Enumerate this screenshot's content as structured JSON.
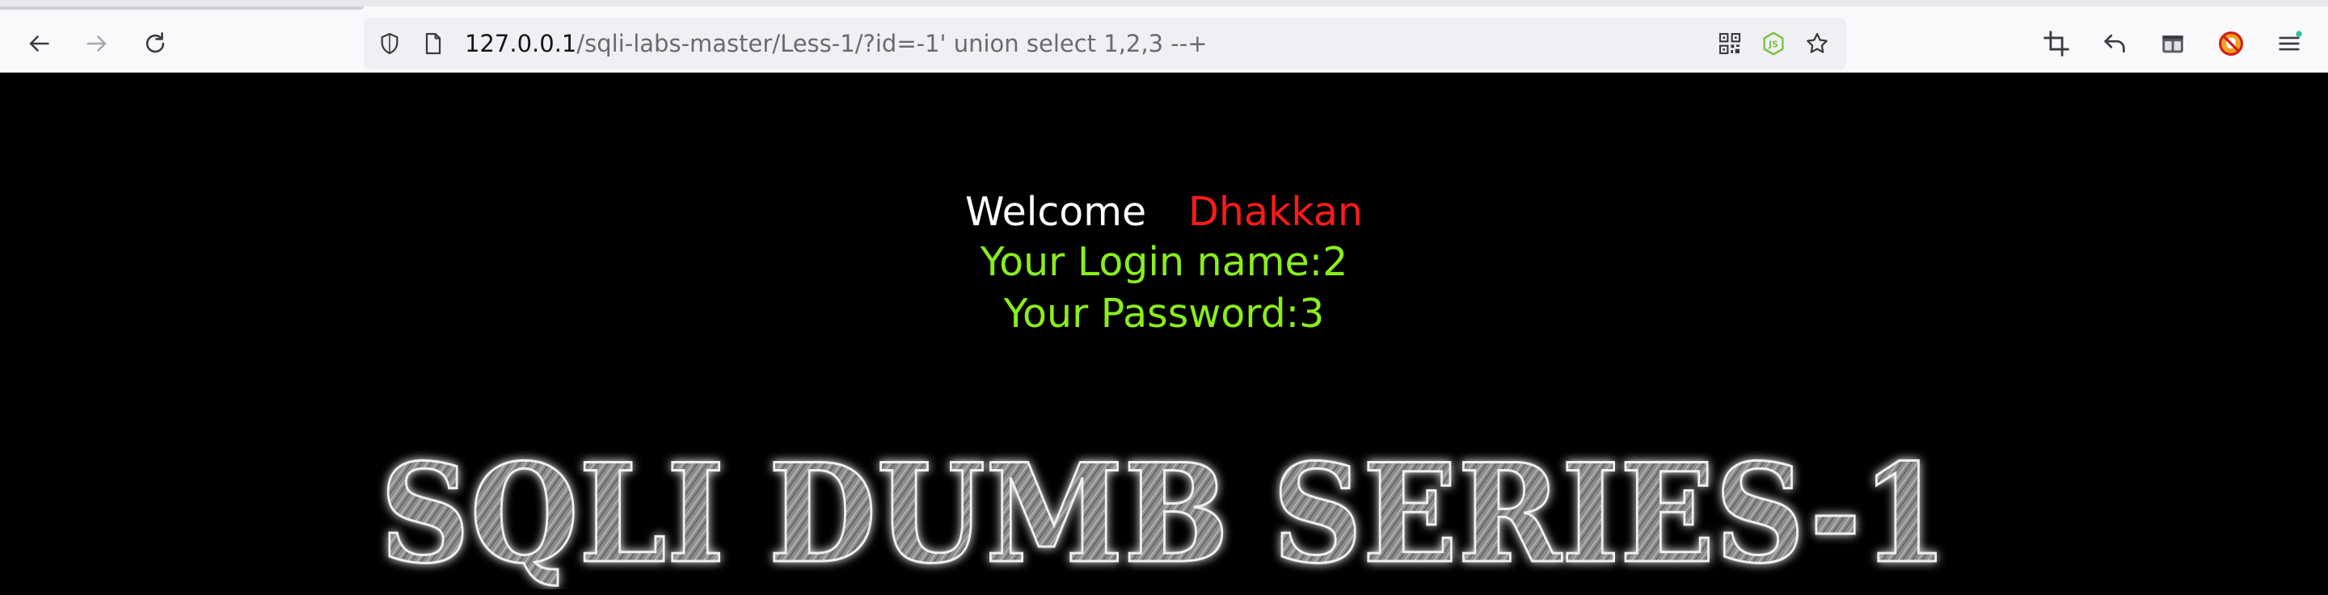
{
  "browser": {
    "url_host": "127.0.0.1",
    "url_path": "/sqli-labs-master/Less-1/?id=-1' union select 1,2,3 --+",
    "icons": {
      "back": "arrow-left-icon",
      "forward": "arrow-right-icon",
      "reload": "reload-icon",
      "tracking_protection": "shield-icon",
      "page_info": "page-icon",
      "qr": "qr-code-icon",
      "node_extension": "nodejs-icon",
      "bookmark": "star-icon",
      "screenshot": "crop-icon",
      "undo": "undo-arrow-icon",
      "containers": "container-icon",
      "blocker": "blocked-extension-icon",
      "menu": "hamburger-menu-icon"
    }
  },
  "page": {
    "welcome_word": "Welcome",
    "welcome_name": "Dhakkan",
    "login_line": "Your Login name:2",
    "password_line": "Your Password:3",
    "banner_text": "SQLI DUMB SERIES-1"
  },
  "colors": {
    "page_background": "#000000",
    "welcome": "#ffffff",
    "name": "#ff1a1a",
    "result_text": "#8aee1a"
  }
}
